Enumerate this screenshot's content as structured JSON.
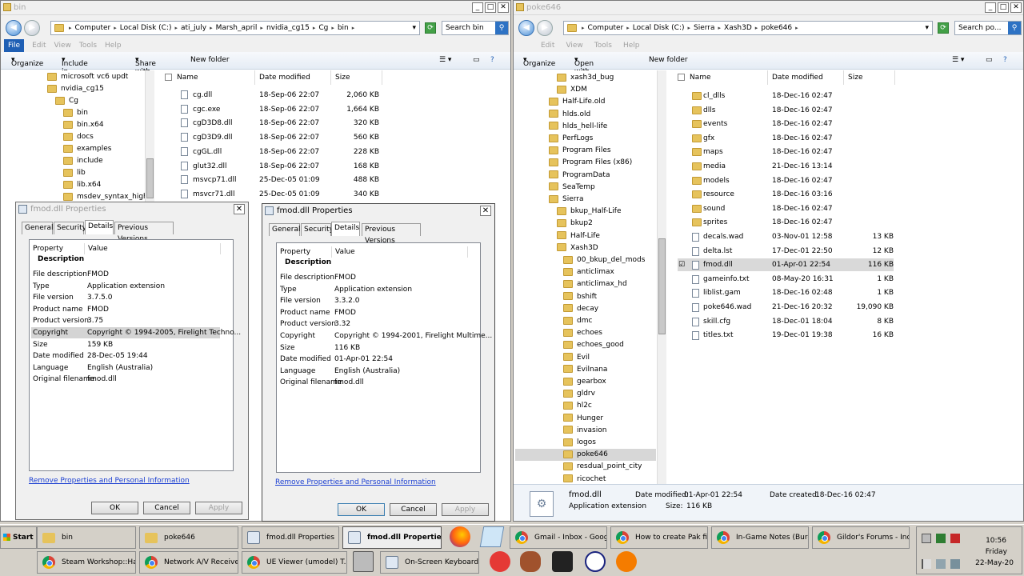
{
  "left_window": {
    "title": "bin",
    "address": [
      "Computer",
      "Local Disk (C:)",
      "ati_july",
      "Marsh_april",
      "nvidia_cg15",
      "Cg",
      "bin"
    ],
    "search_placeholder": "Search bin",
    "menu": [
      "File",
      "Edit",
      "View",
      "Tools",
      "Help"
    ],
    "commands": {
      "organize": "Organize",
      "include": "Include in library",
      "share": "Share with",
      "new_folder": "New folder"
    },
    "tree": [
      "microsoft vc6 updt",
      "nvidia_cg15",
      "Cg",
      "bin",
      "bin.x64",
      "docs",
      "examples",
      "include",
      "lib",
      "lib.x64",
      "msdev_syntax_highlight"
    ],
    "columns": {
      "name": "Name",
      "date": "Date modified",
      "size": "Size"
    },
    "files": [
      {
        "name": "cg.dll",
        "date": "18-Sep-06 22:07",
        "size": "2,060 KB"
      },
      {
        "name": "cgc.exe",
        "date": "18-Sep-06 22:07",
        "size": "1,664 KB"
      },
      {
        "name": "cgD3D8.dll",
        "date": "18-Sep-06 22:07",
        "size": "320 KB"
      },
      {
        "name": "cgD3D9.dll",
        "date": "18-Sep-06 22:07",
        "size": "560 KB"
      },
      {
        "name": "cgGL.dll",
        "date": "18-Sep-06 22:07",
        "size": "228 KB"
      },
      {
        "name": "glut32.dll",
        "date": "18-Sep-06 22:07",
        "size": "168 KB"
      },
      {
        "name": "msvcp71.dll",
        "date": "25-Dec-05 01:09",
        "size": "488 KB"
      },
      {
        "name": "msvcr71.dll",
        "date": "25-Dec-05 01:09",
        "size": "340 KB"
      }
    ]
  },
  "dialog1": {
    "title": "fmod.dll Properties",
    "tabs": [
      "General",
      "Security",
      "Details",
      "Previous Versions"
    ],
    "head_property": "Property",
    "head_value": "Value",
    "group": "Description",
    "props": [
      {
        "k": "File description",
        "v": "FMOD"
      },
      {
        "k": "Type",
        "v": "Application extension"
      },
      {
        "k": "File version",
        "v": "3.7.5.0"
      },
      {
        "k": "Product name",
        "v": "FMOD"
      },
      {
        "k": "Product version",
        "v": "3.75"
      },
      {
        "k": "Copyright",
        "v": "Copyright © 1994-2005, Firelight Techno..."
      },
      {
        "k": "Size",
        "v": "159 KB"
      },
      {
        "k": "Date modified",
        "v": "28-Dec-05 19:44"
      },
      {
        "k": "Language",
        "v": "English (Australia)"
      },
      {
        "k": "Original filename",
        "v": "fmod.dll"
      }
    ],
    "link": "Remove Properties and Personal Information",
    "ok": "OK",
    "cancel": "Cancel",
    "apply": "Apply"
  },
  "dialog2": {
    "title": "fmod.dll Properties",
    "tabs": [
      "General",
      "Security",
      "Details",
      "Previous Versions"
    ],
    "head_property": "Property",
    "head_value": "Value",
    "group": "Description",
    "props": [
      {
        "k": "File description",
        "v": "FMOD"
      },
      {
        "k": "Type",
        "v": "Application extension"
      },
      {
        "k": "File version",
        "v": "3.3.2.0"
      },
      {
        "k": "Product name",
        "v": "FMOD"
      },
      {
        "k": "Product version",
        "v": "3.32"
      },
      {
        "k": "Copyright",
        "v": "Copyright © 1994-2001, Firelight Multime..."
      },
      {
        "k": "Size",
        "v": "116 KB"
      },
      {
        "k": "Date modified",
        "v": "01-Apr-01 22:54"
      },
      {
        "k": "Language",
        "v": "English (Australia)"
      },
      {
        "k": "Original filename",
        "v": "fmod.dll"
      }
    ],
    "link": "Remove Properties and Personal Information",
    "ok": "OK",
    "cancel": "Cancel",
    "apply": "Apply"
  },
  "right_window": {
    "title": "poke646",
    "address": [
      "Computer",
      "Local Disk (C:)",
      "Sierra",
      "Xash3D",
      "poke646"
    ],
    "search_placeholder": "Search po...",
    "menu": [
      "Edit",
      "View",
      "Tools",
      "Help"
    ],
    "commands": {
      "organize": "Organize",
      "open": "Open with...",
      "new_folder": "New folder"
    },
    "tree": [
      {
        "t": "xash3d_bug",
        "lvl": 1
      },
      {
        "t": "XDM",
        "lvl": 1
      },
      {
        "t": "Half-Life.old",
        "lvl": 0
      },
      {
        "t": "hlds.old",
        "lvl": 0
      },
      {
        "t": "hlds_hell-life",
        "lvl": 0
      },
      {
        "t": "PerfLogs",
        "lvl": 0
      },
      {
        "t": "Program Files",
        "lvl": 0
      },
      {
        "t": "Program Files (x86)",
        "lvl": 0
      },
      {
        "t": "ProgramData",
        "lvl": 0
      },
      {
        "t": "SeaTemp",
        "lvl": 0
      },
      {
        "t": "Sierra",
        "lvl": 0
      },
      {
        "t": "bkup_Half-Life",
        "lvl": 1
      },
      {
        "t": "bkup2",
        "lvl": 1
      },
      {
        "t": "Half-Life",
        "lvl": 1
      },
      {
        "t": "Xash3D",
        "lvl": 1
      },
      {
        "t": "00_bkup_del_mods",
        "lvl": 2
      },
      {
        "t": "anticlimax",
        "lvl": 2
      },
      {
        "t": "anticlimax_hd",
        "lvl": 2
      },
      {
        "t": "bshift",
        "lvl": 2
      },
      {
        "t": "decay",
        "lvl": 2
      },
      {
        "t": "dmc",
        "lvl": 2
      },
      {
        "t": "echoes",
        "lvl": 2
      },
      {
        "t": "echoes_good",
        "lvl": 2
      },
      {
        "t": "Evil",
        "lvl": 2
      },
      {
        "t": "Evilnana",
        "lvl": 2
      },
      {
        "t": "gearbox",
        "lvl": 2
      },
      {
        "t": "gldrv",
        "lvl": 2
      },
      {
        "t": "hl2c",
        "lvl": 2
      },
      {
        "t": "Hunger",
        "lvl": 2
      },
      {
        "t": "invasion",
        "lvl": 2
      },
      {
        "t": "logos",
        "lvl": 2
      },
      {
        "t": "poke646",
        "lvl": 2,
        "sel": true
      },
      {
        "t": "resdual_point_city",
        "lvl": 2
      },
      {
        "t": "ricochet",
        "lvl": 2
      }
    ],
    "columns": {
      "name": "Name",
      "date": "Date modified",
      "size": "Size"
    },
    "files": [
      {
        "name": "cl_dlls",
        "date": "18-Dec-16 02:47",
        "size": "",
        "folder": true
      },
      {
        "name": "dlls",
        "date": "18-Dec-16 02:47",
        "size": "",
        "folder": true
      },
      {
        "name": "events",
        "date": "18-Dec-16 02:47",
        "size": "",
        "folder": true
      },
      {
        "name": "gfx",
        "date": "18-Dec-16 02:47",
        "size": "",
        "folder": true
      },
      {
        "name": "maps",
        "date": "18-Dec-16 02:47",
        "size": "",
        "folder": true
      },
      {
        "name": "media",
        "date": "21-Dec-16 13:14",
        "size": "",
        "folder": true
      },
      {
        "name": "models",
        "date": "18-Dec-16 02:47",
        "size": "",
        "folder": true
      },
      {
        "name": "resource",
        "date": "18-Dec-16 03:16",
        "size": "",
        "folder": true
      },
      {
        "name": "sound",
        "date": "18-Dec-16 02:47",
        "size": "",
        "folder": true
      },
      {
        "name": "sprites",
        "date": "18-Dec-16 02:47",
        "size": "",
        "folder": true
      },
      {
        "name": "decals.wad",
        "date": "03-Nov-01 12:58",
        "size": "13 KB"
      },
      {
        "name": "delta.lst",
        "date": "17-Dec-01 22:50",
        "size": "12 KB"
      },
      {
        "name": "fmod.dll",
        "date": "01-Apr-01 22:54",
        "size": "116 KB",
        "sel": true
      },
      {
        "name": "gameinfo.txt",
        "date": "08-May-20 16:31",
        "size": "1 KB"
      },
      {
        "name": "liblist.gam",
        "date": "18-Dec-16 02:48",
        "size": "1 KB"
      },
      {
        "name": "poke646.wad",
        "date": "21-Dec-16 20:32",
        "size": "19,090 KB"
      },
      {
        "name": "skill.cfg",
        "date": "18-Dec-01 18:04",
        "size": "8 KB"
      },
      {
        "name": "titles.txt",
        "date": "19-Dec-01 19:38",
        "size": "16 KB"
      }
    ],
    "details": {
      "name": "fmod.dll",
      "type": "Application extension",
      "modified_label": "Date modified:",
      "modified": "01-Apr-01 22:54",
      "created_label": "Date created:",
      "created": "18-Dec-16 02:47",
      "size_label": "Size:",
      "size": "116 KB"
    }
  },
  "taskbar": {
    "start": "Start",
    "row1": [
      "bin",
      "poke646",
      "fmod.dll Properties",
      "fmod.dll Properties",
      "Gmail - Inbox - Googl...",
      "How to create Pak fil...",
      "In-Game Notes (Bure...",
      "Gildor's Forums - Ind..."
    ],
    "row2": [
      "Steam Workshop::Hal...",
      "Network A/V Receive...",
      "UE Viewer (umodel) T...",
      "On-Screen Keyboard"
    ],
    "time": "10:56",
    "day": "Friday",
    "date": "22-May-20"
  }
}
